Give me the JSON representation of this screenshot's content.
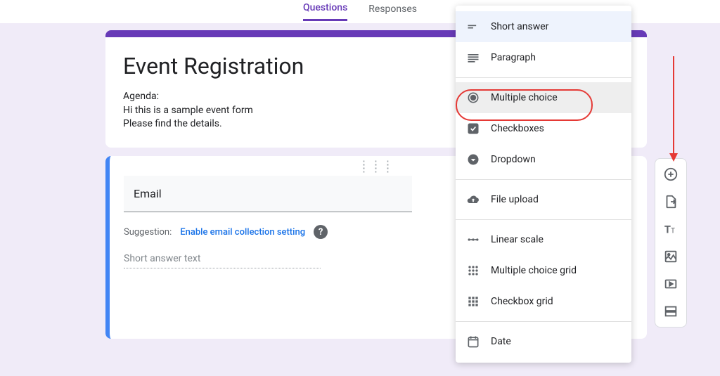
{
  "tabs": {
    "questions": "Questions",
    "responses": "Responses"
  },
  "form": {
    "title": "Event Registration",
    "description": "Agenda:\nHi this is a sample event form\nPlease find the details."
  },
  "question": {
    "title": "Email",
    "suggestion_label": "Suggestion:",
    "suggestion_link": "Enable email collection setting",
    "short_answer_placeholder": "Short answer text"
  },
  "type_menu": {
    "short_answer": "Short answer",
    "paragraph": "Paragraph",
    "multiple_choice": "Multiple choice",
    "checkboxes": "Checkboxes",
    "dropdown": "Dropdown",
    "file_upload": "File upload",
    "linear_scale": "Linear scale",
    "multiple_choice_grid": "Multiple choice grid",
    "checkbox_grid": "Checkbox grid",
    "date": "Date"
  }
}
